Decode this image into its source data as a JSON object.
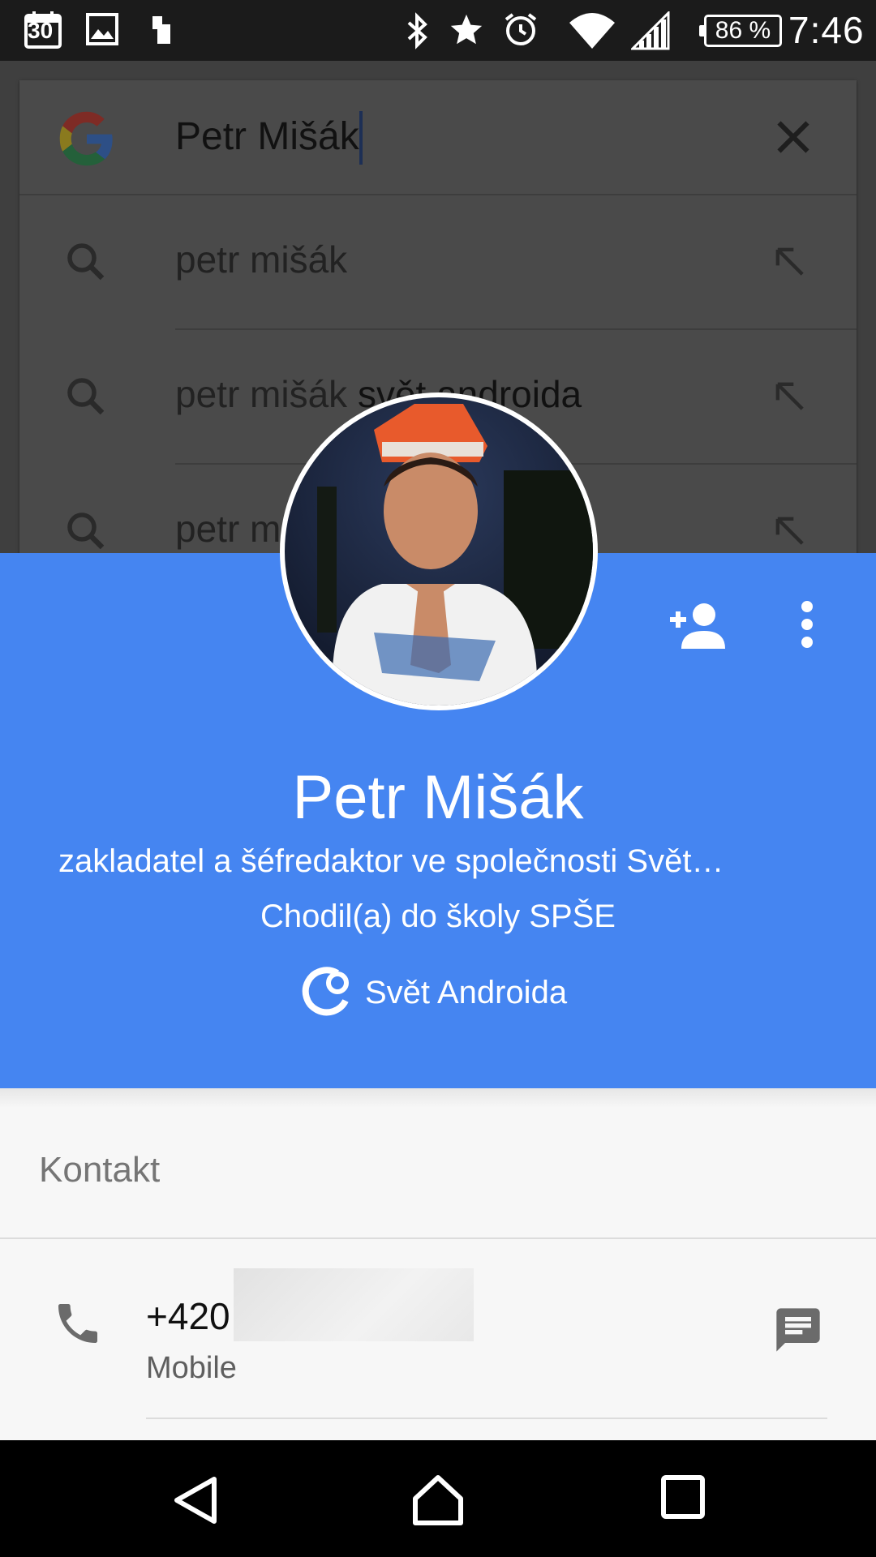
{
  "status_bar": {
    "calendar_day": "30",
    "battery_percent": "86 %",
    "time": "7:46",
    "icons": [
      "calendar-icon",
      "gallery-icon",
      "sd-card-icon",
      "bluetooth-icon",
      "star-icon",
      "alarm-icon",
      "wifi-icon",
      "signal-icon",
      "battery-icon"
    ]
  },
  "search": {
    "query": "Petr Mišák",
    "suggestions": [
      {
        "prefix": "petr mišák",
        "suffix": ""
      },
      {
        "prefix": "petr mišák",
        "suffix": " svět androida"
      },
      {
        "prefix": "petr m",
        "suffix": ""
      }
    ]
  },
  "contact": {
    "name": "Petr Mišák",
    "title": "zakladatel a šéfredaktor ve společnosti Svět…",
    "school": "Chodil(a) do školy SPŠE",
    "website": "Svět Androida",
    "accent_color": "#4585f1"
  },
  "contact_section": {
    "heading": "Kontakt",
    "phone_prefix": "+420",
    "phone_type": "Mobile"
  }
}
